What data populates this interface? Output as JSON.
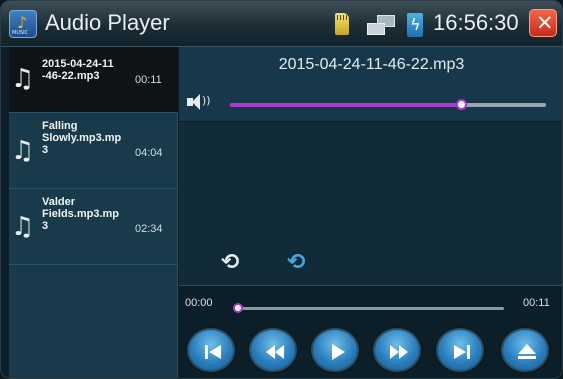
{
  "titlebar": {
    "title": "Audio Player",
    "app_icon_label": "MUSIC",
    "time": "16:56:30"
  },
  "playlist": [
    {
      "name": "2015-04-24-11-46-22.mp3",
      "display": "2015-04-24-11\n-46-22.mp3",
      "duration": "00:11",
      "selected": true
    },
    {
      "name": "Falling Slowly.mp3",
      "display": "Falling\nSlowly.mp3.mp\n3",
      "duration": "04:04",
      "selected": false
    },
    {
      "name": "Valder Fields.mp3",
      "display": "Valder\nFields.mp3.mp\n3",
      "duration": "02:34",
      "selected": false
    }
  ],
  "now_playing": {
    "title": "2015-04-24-11-46-22.mp3",
    "volume_fraction": 0.73
  },
  "playback": {
    "elapsed": "00:00",
    "total": "00:11",
    "progress_fraction": 0.0
  },
  "controls": [
    "previous-track",
    "rewind",
    "play",
    "fast-forward",
    "next-track",
    "eject"
  ],
  "colors": {
    "accent": "#a83cc8",
    "button": "#2b7fbd",
    "close": "#d93a22"
  }
}
